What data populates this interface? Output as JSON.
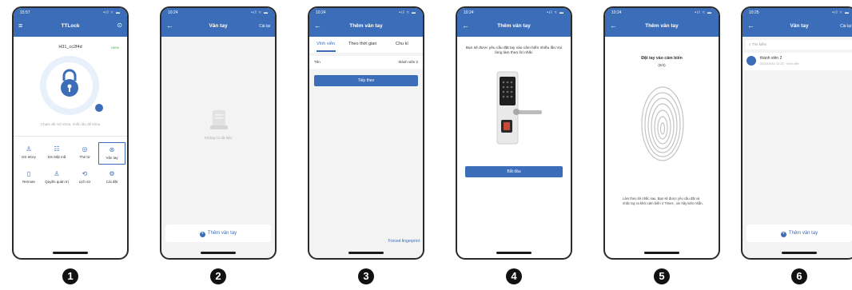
{
  "steps": [
    "1",
    "2",
    "3",
    "4",
    "5",
    "6"
  ],
  "status": {
    "p1_time": "15:57",
    "p2_time": "10:24",
    "p3_time": "10:24",
    "p4_time": "10:24",
    "p5_time": "10:24",
    "p6_time": "10:25",
    "icons": "•ıl ≈ ▬"
  },
  "phone1": {
    "menu_icon": "≡",
    "title": "TTLock",
    "settings_icon": "⊙",
    "lock_name": "H31_cc2f4d",
    "battery": "100%",
    "hint": "Chạm để mở khóa, nhấn lâu để khóa",
    "grid": [
      "DS eKey",
      "DS Mật mã",
      "Thẻ từ",
      "Vân tay",
      "Remote",
      "Quyền quản trị",
      "Lịch sử",
      "Cài đặt"
    ],
    "grid_icons": [
      "♙",
      "☷",
      "◎",
      "⊛",
      "▯",
      "♙",
      "⟲",
      "⚙"
    ]
  },
  "phone2": {
    "back_icon": "←",
    "title": "Vân tay",
    "right": "Cài lại",
    "empty_text": "Không có dữ liệu",
    "add_button": "Thêm vân tay"
  },
  "phone3": {
    "back_icon": "←",
    "title": "Thêm vân tay",
    "tabs": [
      "Vĩnh viễn",
      "Theo thời gian",
      "Chu kì"
    ],
    "name_label": "Tên",
    "name_value": "thành viên 2",
    "next_button": "Tiếp theo",
    "forced_link": "Forced fingerprint"
  },
  "phone4": {
    "back_icon": "←",
    "title": "Thêm vân tay",
    "instruction": "Bạn sẽ được yêu cầu đặt tay vào cảm biến nhiều lần.Vui lòng làm theo lời nhắc",
    "start_button": "Bắt đầu"
  },
  "phone5": {
    "back_icon": "←",
    "title": "Thêm vân tay",
    "heading": "Đặt tay vào cảm biến",
    "progress": "(0/4)",
    "note": "Làm theo lời nhắc sau. Bạn sẽ được yêu cầu đặt và nhấc tay ra khỏi cảm biến 4 Times , xin hãy kiên nhẫn."
  },
  "phone6": {
    "back_icon": "←",
    "title": "Vân tay",
    "right": "Cài lại",
    "search_placeholder": "Tìm kiếm",
    "item_name": "thành viên 2",
    "item_date": "2022/05/31 10:25 · Vĩnh viễn",
    "add_button": "Thêm vân tay"
  },
  "colors": {
    "header": "#3b6db8",
    "accent": "#3b6db8"
  }
}
